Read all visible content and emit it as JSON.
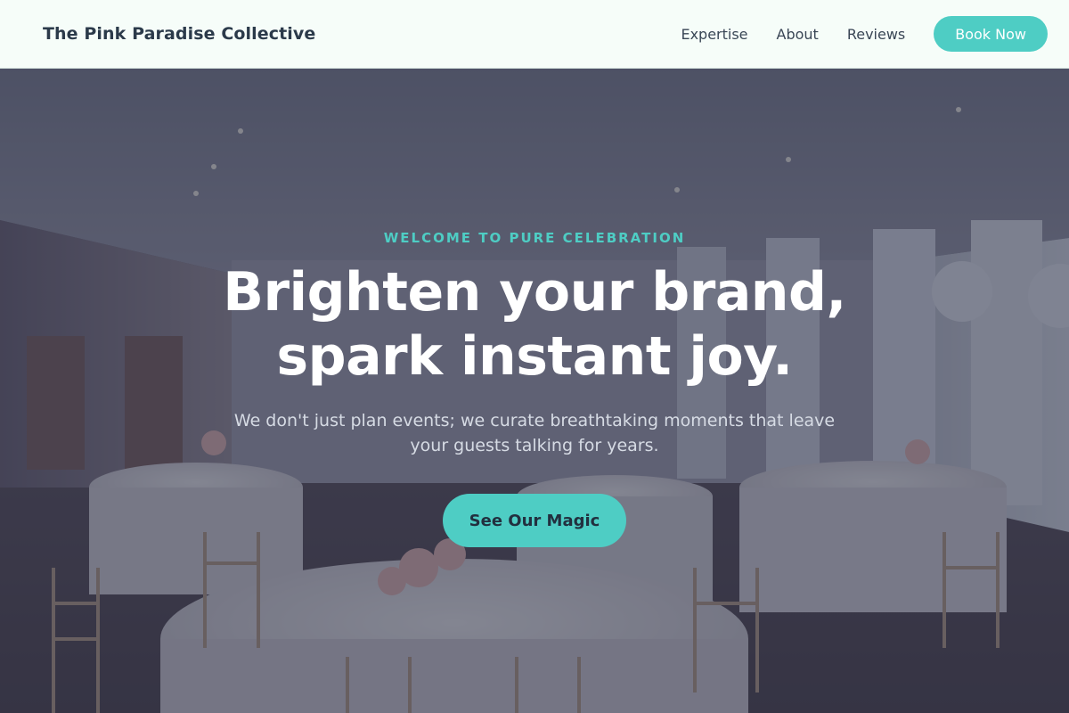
{
  "header": {
    "brand": "The Pink Paradise Collective",
    "nav": [
      {
        "label": "Expertise"
      },
      {
        "label": "About"
      },
      {
        "label": "Reviews"
      }
    ],
    "cta_label": "Book Now"
  },
  "hero": {
    "eyebrow": "WELCOME TO PURE CELEBRATION",
    "headline_line1": "Brighten your brand,",
    "headline_line2": "spark instant joy.",
    "subtext": "We don't just plan events; we curate breathtaking moments that leave your guests talking for years.",
    "cta_label": "See Our Magic"
  },
  "colors": {
    "accent": "#4ecdc4",
    "brand_text": "#2b3a4a",
    "header_bg": "#f6fdf9"
  }
}
